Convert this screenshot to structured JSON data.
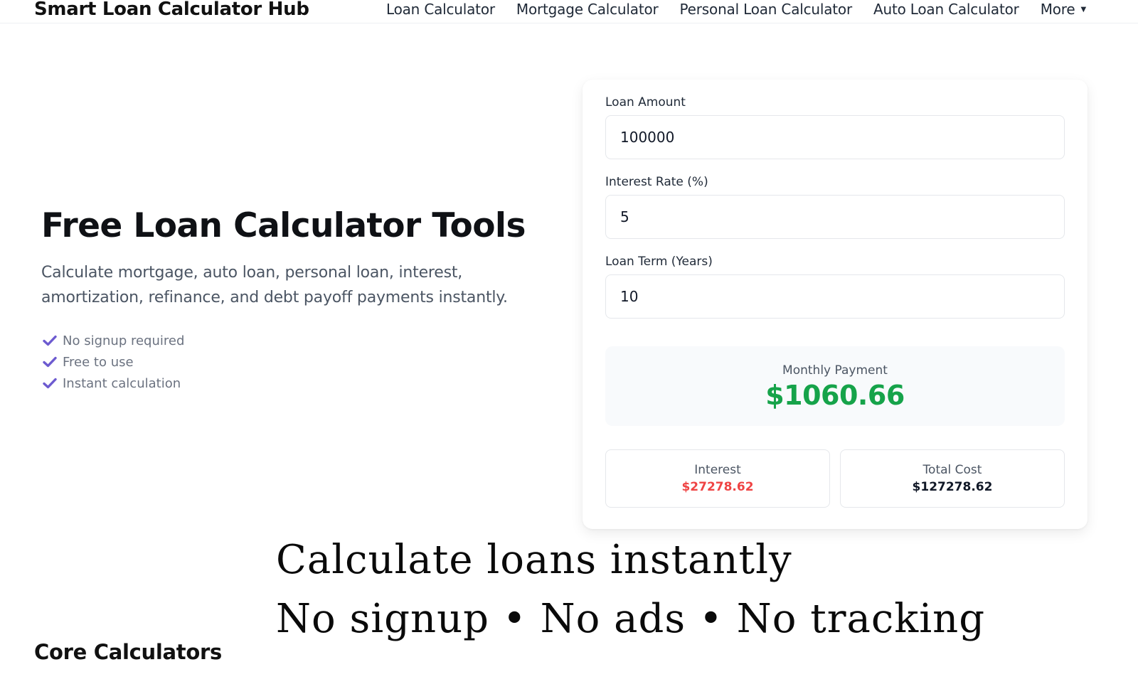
{
  "header": {
    "brand": "Smart Loan Calculator Hub",
    "nav": [
      {
        "label": "Loan Calculator"
      },
      {
        "label": "Mortgage Calculator"
      },
      {
        "label": "Personal Loan Calculator"
      },
      {
        "label": "Auto Loan Calculator"
      }
    ],
    "more_label": "More",
    "more_icon": "caret-down-icon"
  },
  "hero": {
    "title": "Free Loan Calculator Tools",
    "description": "Calculate mortgage, auto loan, personal loan, interest, amortization, refinance, and debt payoff payments instantly.",
    "features": [
      {
        "label": "No signup required",
        "icon": "check-icon"
      },
      {
        "label": "Free to use",
        "icon": "check-icon"
      },
      {
        "label": "Instant calculation",
        "icon": "check-icon"
      }
    ]
  },
  "calculator": {
    "amount_label": "Loan Amount",
    "amount_value": "100000",
    "rate_label": "Interest Rate (%)",
    "rate_value": "5",
    "term_label": "Loan Term (Years)",
    "term_value": "10",
    "monthly_label": "Monthly Payment",
    "monthly_value": "$1060.66",
    "interest_label": "Interest",
    "interest_value": "$27278.62",
    "total_label": "Total Cost",
    "total_value": "$127278.62"
  },
  "overlay": {
    "line1": "Calculate loans instantly",
    "line2": "No signup • No ads • No tracking"
  },
  "sections": {
    "core_title": "Core Calculators"
  },
  "colors": {
    "accent_check": "#6d5bd0",
    "payment_green": "#16a34a",
    "interest_red": "#ef4444"
  }
}
